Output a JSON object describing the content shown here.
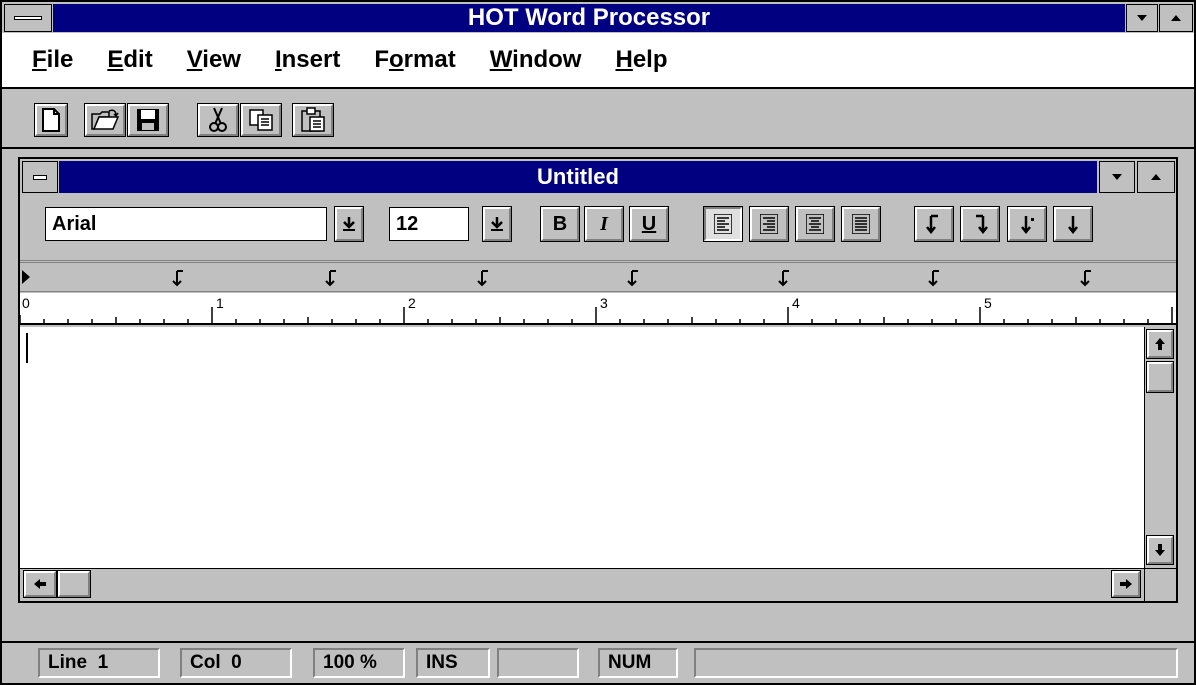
{
  "app": {
    "title": "HOT Word Processor"
  },
  "menu": {
    "file": "File",
    "edit": "Edit",
    "view": "View",
    "insert": "Insert",
    "format": "Format",
    "window": "Window",
    "help": "Help"
  },
  "toolbar": {
    "icons": [
      "new-document-icon",
      "open-folder-icon",
      "save-disk-icon",
      "cut-scissors-icon",
      "copy-icon",
      "paste-clipboard-icon"
    ]
  },
  "document": {
    "title": "Untitled"
  },
  "format_bar": {
    "font_name": "Arial",
    "font_size": "12",
    "bold": "B",
    "italic": "I",
    "underline": "U",
    "align_left_active": true
  },
  "ruler": {
    "numbers": [
      "0",
      "1",
      "2",
      "3",
      "4",
      "5"
    ]
  },
  "status": {
    "line": "Line  1",
    "col": "Col  0",
    "zoom": "100 %",
    "ins": "INS",
    "blank": "",
    "num": "NUM"
  },
  "colors": {
    "titlebar": "#000080",
    "face": "#c0c0c0"
  }
}
